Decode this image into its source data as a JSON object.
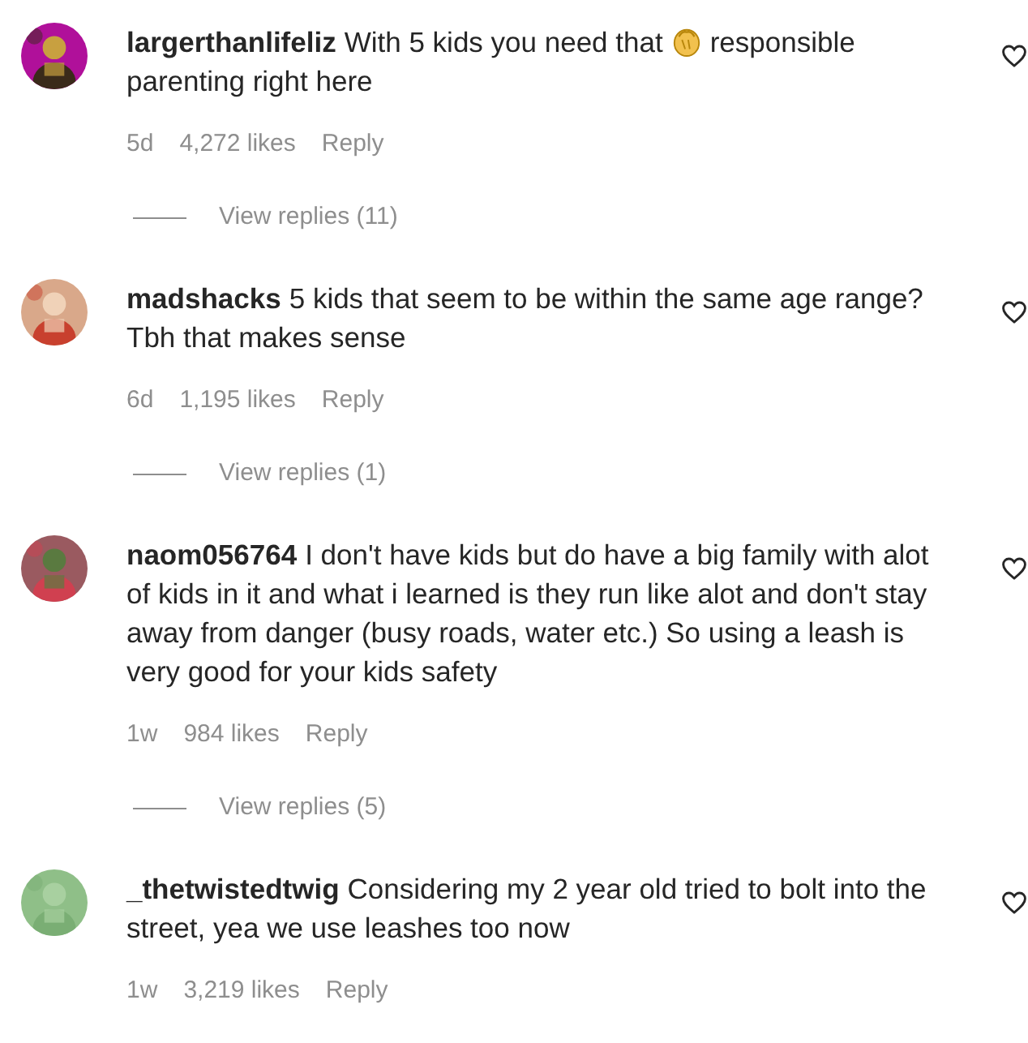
{
  "comments": [
    {
      "avatar": {
        "kind": "picture"
      },
      "username": "largerthanlifeliz",
      "segments": [
        {
          "kind": "text",
          "text": "With 5 kids you need that"
        },
        {
          "kind": "emoji"
        },
        {
          "kind": "text",
          "text": "responsible parenting right here"
        }
      ],
      "time": "5d",
      "likes": "4,272 likes",
      "reply": "Reply",
      "view_replies": "View replies (11)",
      "liked": false
    },
    {
      "avatar": {
        "kind": "picture"
      },
      "username": "madshacks",
      "segments": [
        {
          "kind": "text",
          "text": "5 kids that seem to be within the same age range? Tbh that makes sense"
        }
      ],
      "time": "6d",
      "likes": "1,195 likes",
      "reply": "Reply",
      "view_replies": "View replies (1)",
      "liked": false
    },
    {
      "avatar": {
        "kind": "picture"
      },
      "username": "naom056764",
      "segments": [
        {
          "kind": "text",
          "text": "I don't have kids but do have a big family with alot of kids in it and what i learned is they run like alot and don't stay away from danger (busy roads, water etc.) So using a leash is very good for your kids safety"
        }
      ],
      "time": "1w",
      "likes": "984 likes",
      "reply": "Reply",
      "view_replies": "View replies (5)",
      "liked": false
    },
    {
      "avatar": {
        "kind": "picture"
      },
      "username": "_thetwistedtwig",
      "segments": [
        {
          "kind": "text",
          "text": "Considering my 2 year old tried to bolt into the street, yea we use leashes too now"
        }
      ],
      "time": "1w",
      "likes": "3,219 likes",
      "reply": "Reply",
      "liked": false
    }
  ]
}
